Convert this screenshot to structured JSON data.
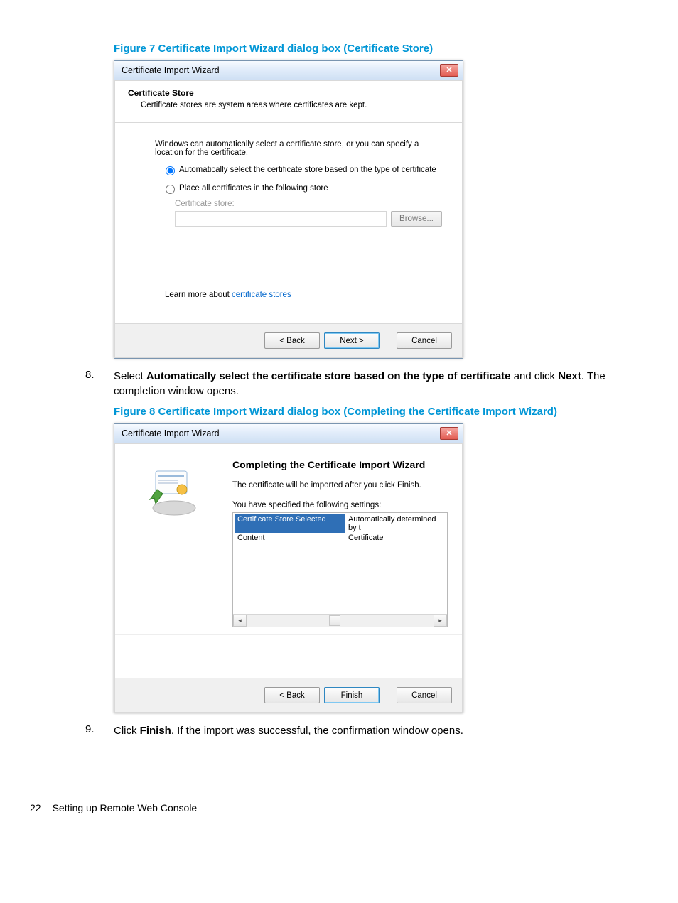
{
  "figure7_caption": "Figure 7 Certificate Import Wizard dialog box (Certificate Store)",
  "dlg1": {
    "title": "Certificate Import Wizard",
    "header": "Certificate Store",
    "subheader": "Certificate stores are system areas where certificates are kept.",
    "intro": "Windows can automatically select a certificate store, or you can specify a location for the certificate.",
    "radio_auto": "Automatically select the certificate store based on the type of certificate",
    "radio_place": "Place all certificates in the following store",
    "store_label": "Certificate store:",
    "browse": "Browse...",
    "learn_prefix": "Learn more about ",
    "learn_link": "certificate stores",
    "back": "< Back",
    "next": "Next >",
    "cancel": "Cancel"
  },
  "step8": {
    "num": "8.",
    "text_pre": "Select ",
    "bold1": "Automatically select the certificate store based on the type of certificate",
    "mid": " and click ",
    "bold2": "Next",
    "after": ". The completion window opens."
  },
  "figure8_caption": "Figure 8 Certificate Import Wizard dialog box (Completing the Certificate Import Wizard)",
  "dlg2": {
    "title": "Certificate Import Wizard",
    "heading": "Completing the Certificate Import Wizard",
    "line1": "The certificate will be imported after you click Finish.",
    "line2": "You have specified the following settings:",
    "rows": [
      {
        "k": "Certificate Store Selected",
        "v": "Automatically determined by t"
      },
      {
        "k": "Content",
        "v": "Certificate"
      }
    ],
    "back": "< Back",
    "finish": "Finish",
    "cancel": "Cancel"
  },
  "step9": {
    "num": "9.",
    "text_pre": "Click ",
    "bold1": "Finish",
    "after": ". If the import was successful, the confirmation window opens."
  },
  "footer": {
    "page": "22",
    "text": "Setting up Remote Web Console"
  }
}
